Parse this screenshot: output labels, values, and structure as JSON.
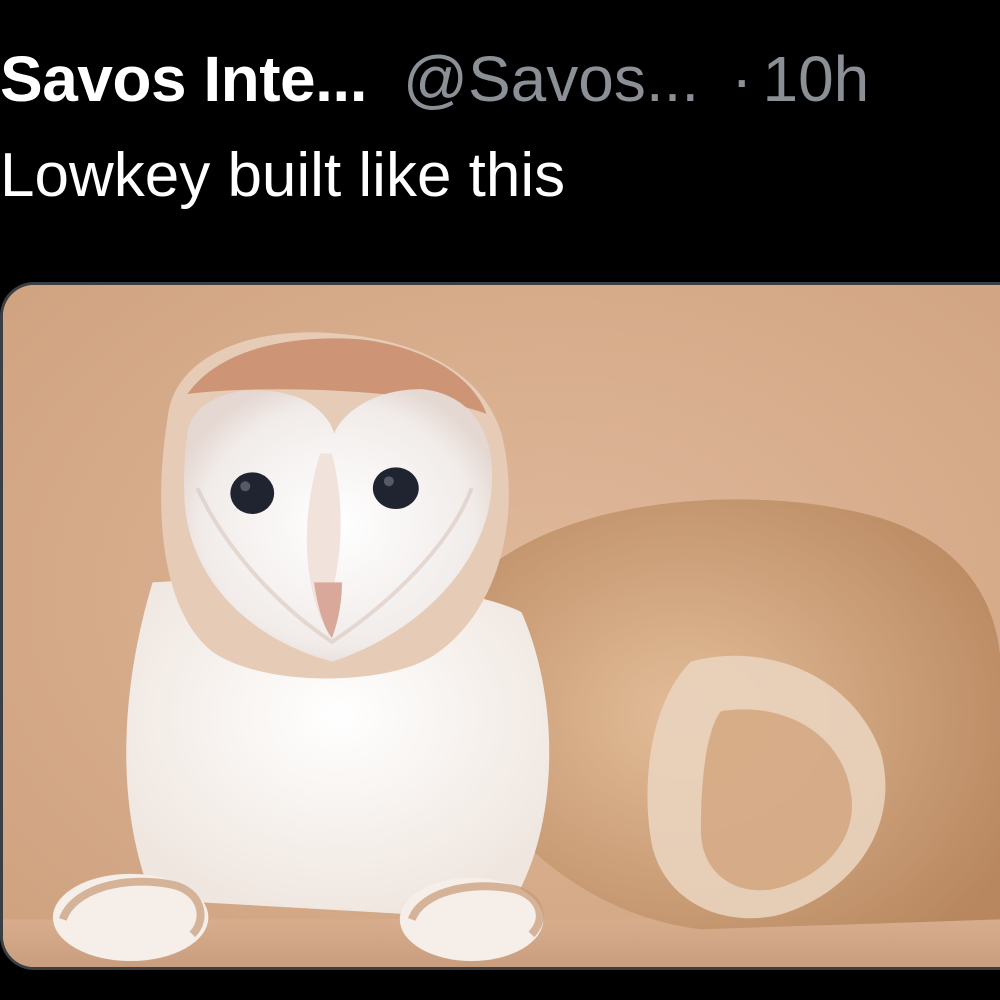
{
  "tweet": {
    "display_name": "Savos Inte...",
    "handle": "@Savos...",
    "separator": "·",
    "timestamp": "10h",
    "text": "Lowkey built like this"
  },
  "media": {
    "icon": "photo",
    "colors": {
      "background": "#d8b091",
      "fur_light": "#fbf6f1",
      "fur_tan": "#c6976c",
      "face_ring": "#c88b6a",
      "eyes": "#1f2430"
    }
  },
  "colors": {
    "page_background": "#000000",
    "primary_text": "#ffffff",
    "secondary_text": "#8b9096",
    "card_border": "#3a3f44"
  }
}
